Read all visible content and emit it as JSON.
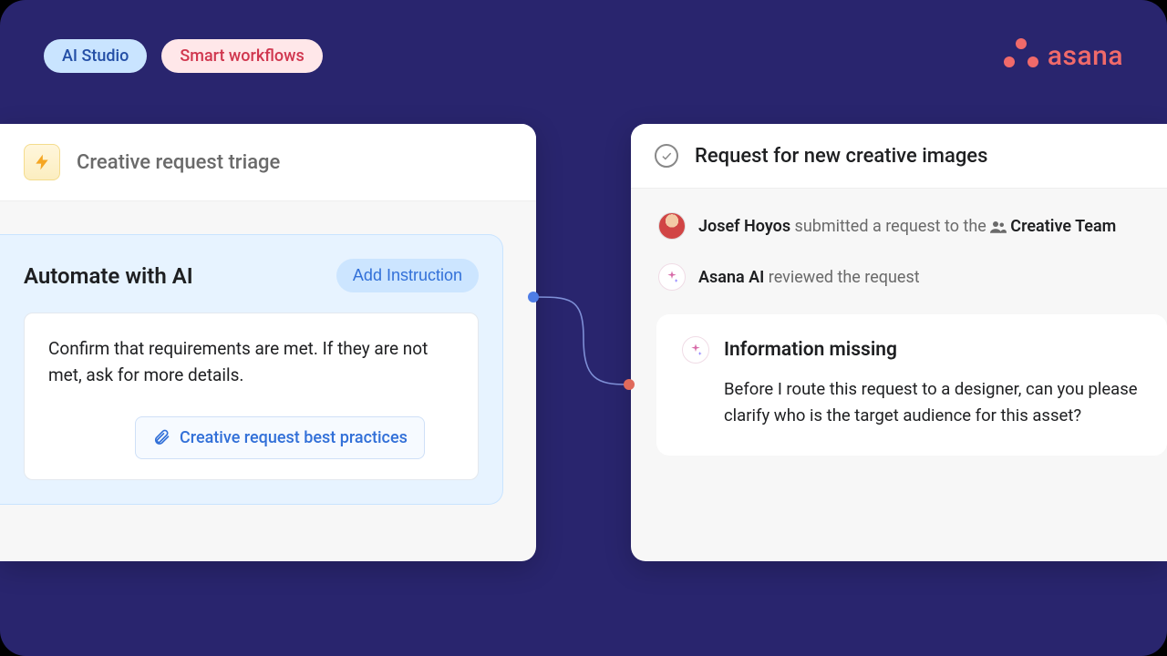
{
  "header": {
    "pill1": "AI Studio",
    "pill2": "Smart workflows",
    "brand": "asana"
  },
  "left": {
    "title": "Creative request triage",
    "ai_title": "Automate with AI",
    "add_instruction": "Add Instruction",
    "instruction": "Confirm that requirements are met. If they are not met, ask for more details.",
    "attachment": "Creative request best practices"
  },
  "right": {
    "title": "Request for new creative images",
    "feed1_user": "Josef Hoyos",
    "feed1_action": " submitted a request to the ",
    "feed1_team": "Creative Team",
    "feed2_user": "Asana AI",
    "feed2_action": " reviewed the request",
    "response_title": "Information missing",
    "response_body": "Before I route this request to a designer, can you please clarify who is the target audience for this asset?"
  }
}
